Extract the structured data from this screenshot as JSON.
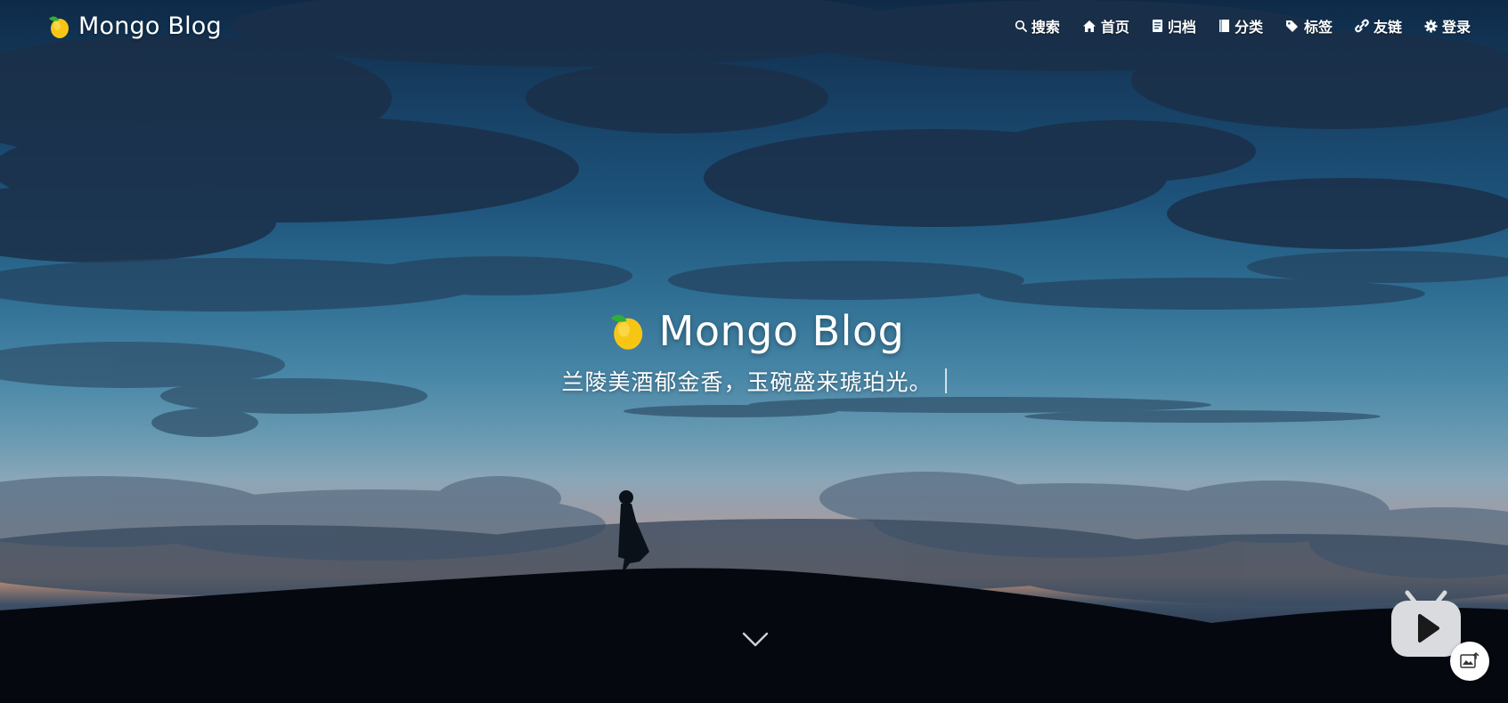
{
  "site": {
    "brand": "Mongo Blog",
    "logo_icon": "mango-icon"
  },
  "nav": {
    "items": [
      {
        "label": "搜索",
        "icon": "search-icon"
      },
      {
        "label": "首页",
        "icon": "home-icon"
      },
      {
        "label": "归档",
        "icon": "archive-icon"
      },
      {
        "label": "分类",
        "icon": "book-icon"
      },
      {
        "label": "标签",
        "icon": "tags-icon"
      },
      {
        "label": "友链",
        "icon": "link-icon"
      },
      {
        "label": "登录",
        "icon": "gear-icon"
      }
    ]
  },
  "hero": {
    "title": "Mongo Blog",
    "subtitle": "兰陵美酒郁金香，玉碗盛来琥珀光。",
    "scroll_icon": "chevron-down-icon"
  },
  "widgets": {
    "tv_icon": "bilibili-tv-play-icon",
    "image_icon": "image-upload-icon"
  },
  "colors": {
    "text": "#ffffff",
    "mango": "#f7c615",
    "leaf": "#2fae3a"
  }
}
